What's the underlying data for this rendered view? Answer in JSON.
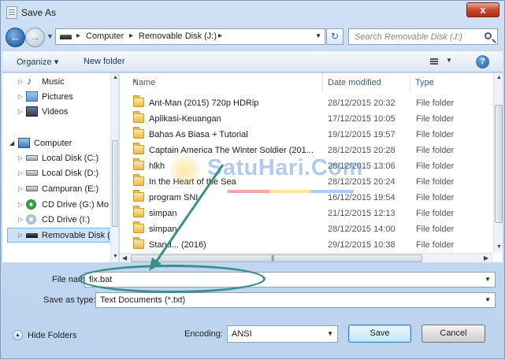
{
  "window": {
    "title": "Save As",
    "close_label": "x"
  },
  "address": {
    "crumbs": [
      "Computer",
      "Removable Disk (J:)"
    ],
    "search_placeholder": "Search Removable Disk (J:)"
  },
  "toolbar": {
    "organize_label": "Organize ▾",
    "new_folder_label": "New folder",
    "help_label": "?"
  },
  "nav": {
    "items": [
      {
        "label": "Music",
        "icon": "music-icon"
      },
      {
        "label": "Pictures",
        "icon": "pictures-icon"
      },
      {
        "label": "Videos",
        "icon": "videos-icon"
      },
      {
        "label": "Computer",
        "icon": "computer-icon"
      },
      {
        "label": "Local Disk (C:)",
        "icon": "disk-icon"
      },
      {
        "label": "Local Disk (D:)",
        "icon": "disk-icon"
      },
      {
        "label": "Campuran (E:)",
        "icon": "disk-icon"
      },
      {
        "label": "CD Drive (G:) Mo",
        "icon": "cd-icon"
      },
      {
        "label": "CD Drive (I:)",
        "icon": "cd-icon"
      },
      {
        "label": "Removable Disk (",
        "icon": "removable-disk-icon"
      }
    ]
  },
  "columns": {
    "name": "Name",
    "date": "Date modified",
    "type": "Type"
  },
  "files": [
    {
      "name": "Ant-Man (2015) 720p HDRip",
      "date": "28/12/2015 20:32",
      "type": "File folder"
    },
    {
      "name": "Aplikasi-Keuangan",
      "date": "17/12/2015 10:05",
      "type": "File folder"
    },
    {
      "name": "Bahas As Biasa + Tutorial",
      "date": "19/12/2015 19:57",
      "type": "File folder"
    },
    {
      "name": "Captain America The Winter Soldier (201...",
      "date": "28/12/2015 20:28",
      "type": "File folder"
    },
    {
      "name": "hlkh",
      "date": "28/12/2015 13:06",
      "type": "File folder"
    },
    {
      "name": "In the Heart of the Sea",
      "date": "28/12/2015 20:24",
      "type": "File folder"
    },
    {
      "name": "program SNI",
      "date": "16/12/2015 19:54",
      "type": "File folder"
    },
    {
      "name": "simpan",
      "date": "21/12/2015 12:13",
      "type": "File folder"
    },
    {
      "name": "simpan",
      "date": "28/12/2015 14:00",
      "type": "File folder"
    },
    {
      "name": "Stand... (2016)",
      "date": "29/12/2015 10:38",
      "type": "File folder"
    }
  ],
  "form": {
    "filename_label": "File name:",
    "filename_value": "fix.bat",
    "saveas_label": "Save as type:",
    "saveas_value": "Text Documents (*.txt)",
    "encoding_label": "Encoding:",
    "encoding_value": "ANSI"
  },
  "footer": {
    "hide_folders_label": "Hide Folders",
    "save_label": "Save",
    "cancel_label": "Cancel"
  },
  "watermark": {
    "text": "SatuHari.Com"
  },
  "colors": {
    "callout": "#3a8f86",
    "accent": "#2a67b3"
  }
}
